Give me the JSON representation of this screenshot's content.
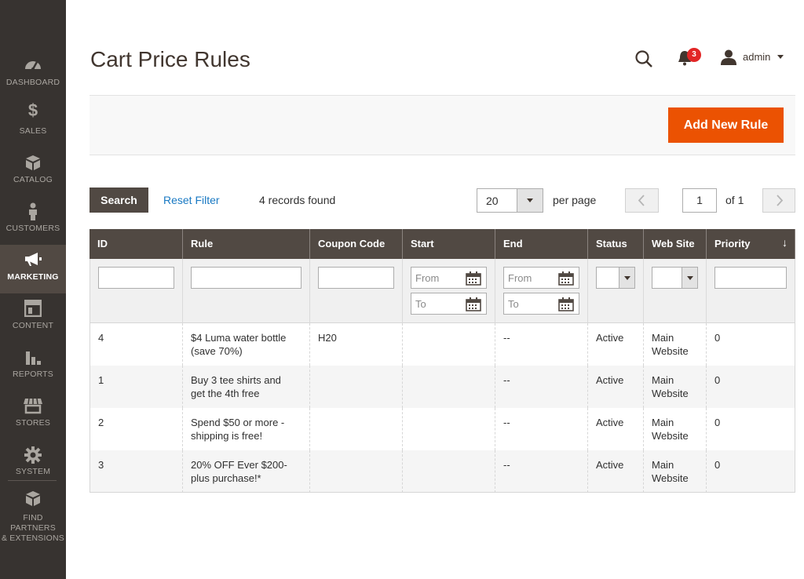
{
  "sidebar": {
    "items": [
      {
        "label": "DASHBOARD",
        "icon": "dashboard-icon"
      },
      {
        "label": "SALES",
        "icon": "dollar-icon"
      },
      {
        "label": "CATALOG",
        "icon": "cube-icon"
      },
      {
        "label": "CUSTOMERS",
        "icon": "person-icon"
      },
      {
        "label": "MARKETING",
        "icon": "megaphone-icon"
      },
      {
        "label": "CONTENT",
        "icon": "layout-icon"
      },
      {
        "label": "REPORTS",
        "icon": "bar-chart-icon"
      },
      {
        "label": "STORES",
        "icon": "storefront-icon"
      },
      {
        "label": "SYSTEM",
        "icon": "gear-icon"
      }
    ],
    "partners": {
      "line1": "FIND PARTNERS",
      "line2": "& EXTENSIONS"
    },
    "active_color": "#514943"
  },
  "header": {
    "title": "Cart Price Rules",
    "notifications_count": "3",
    "user": "admin"
  },
  "actions": {
    "add_new_rule": "Add New Rule",
    "accent_color": "#eb5202"
  },
  "toolbar": {
    "search": "Search",
    "reset_filter": "Reset Filter",
    "records_found": "4 records found",
    "per_page_value": "20",
    "per_page_label": "per page",
    "page": "1",
    "of_pages": "of 1"
  },
  "grid": {
    "columns": [
      "ID",
      "Rule",
      "Coupon Code",
      "Start",
      "End",
      "Status",
      "Web Site",
      "Priority"
    ],
    "filters": {
      "from": "From",
      "to": "To"
    },
    "rows": [
      {
        "id": "4",
        "rule1": "$4 Luma water bottle",
        "rule2": "(save 70%)",
        "coupon": "H20",
        "start": "",
        "end": "--",
        "status": "Active",
        "site1": "Main",
        "site2": "Website",
        "priority": "0"
      },
      {
        "id": "1",
        "rule1": "Buy 3 tee shirts and",
        "rule2": "get the 4th free",
        "coupon": "",
        "start": "",
        "end": "--",
        "status": "Active",
        "site1": "Main",
        "site2": "Website",
        "priority": "0"
      },
      {
        "id": "2",
        "rule1": "Spend $50 or more -",
        "rule2": "shipping is free!",
        "coupon": "",
        "start": "",
        "end": "--",
        "status": "Active",
        "site1": "Main",
        "site2": "Website",
        "priority": "0"
      },
      {
        "id": "3",
        "rule1": "20% OFF Ever $200-",
        "rule2": "plus purchase!*",
        "coupon": "",
        "start": "",
        "end": "--",
        "status": "Active",
        "site1": "Main",
        "site2": "Website",
        "priority": "0"
      }
    ]
  }
}
